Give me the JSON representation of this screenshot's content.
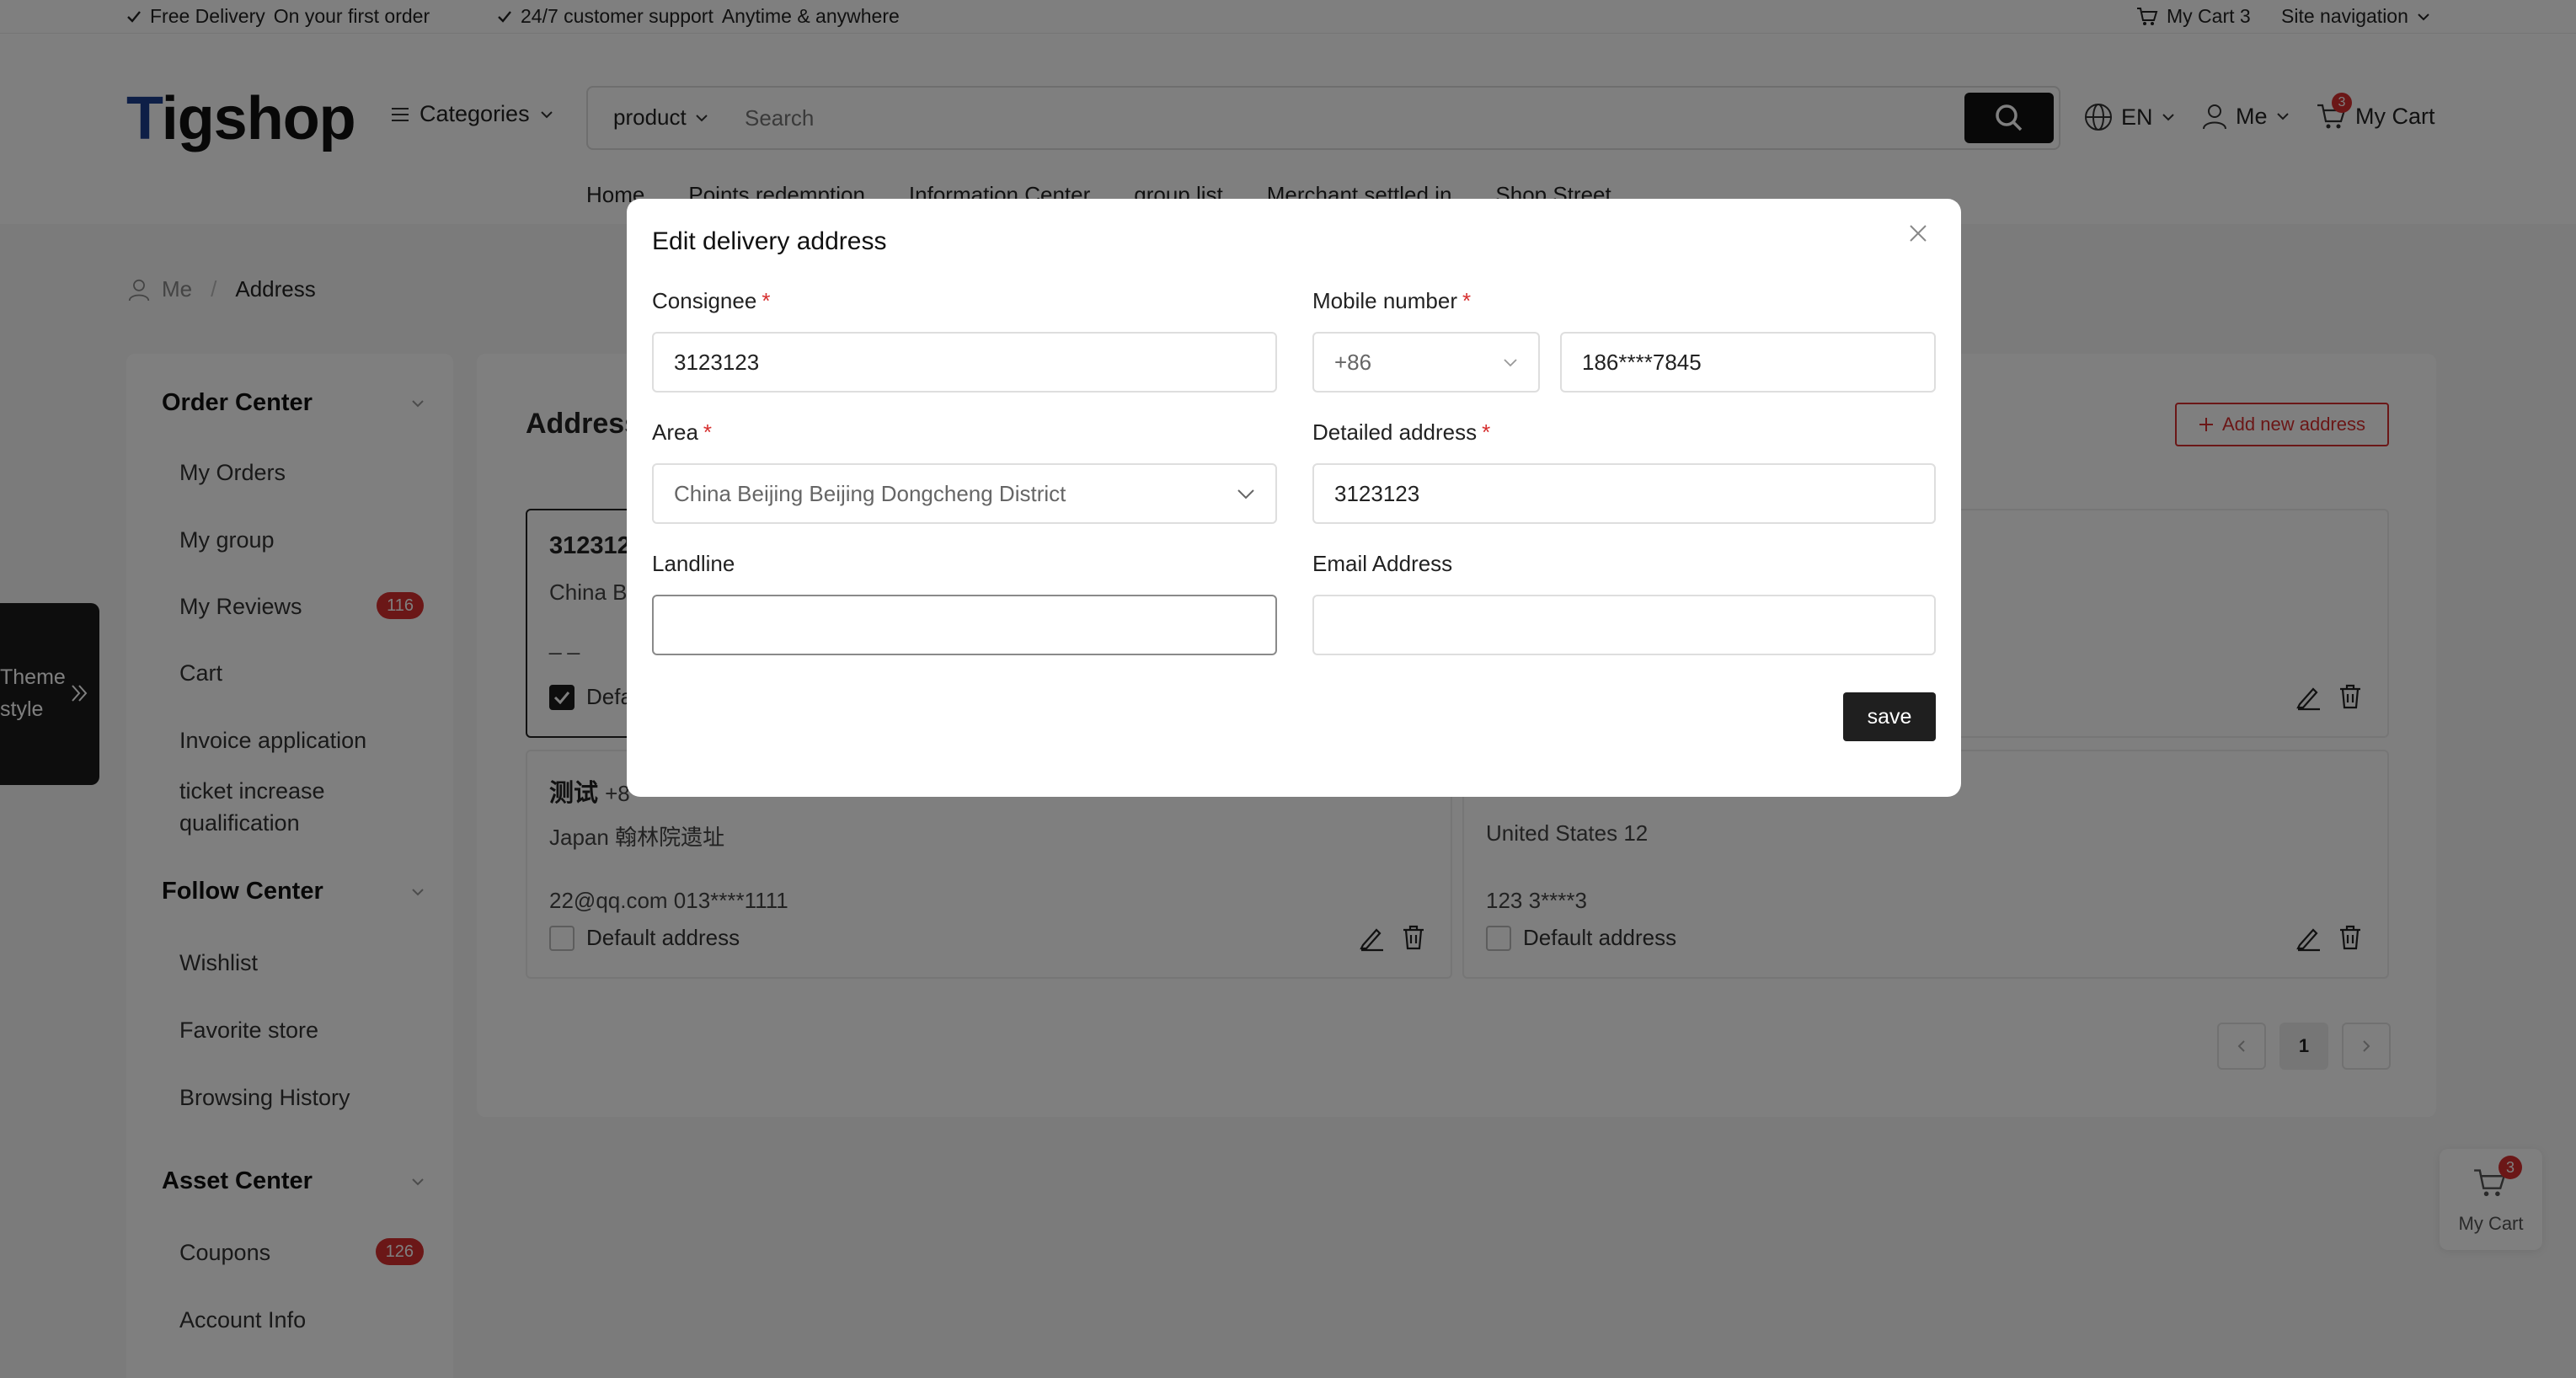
{
  "topbar": {
    "free_delivery": "Free Delivery",
    "free_delivery_sub": "On your first order",
    "support": "24/7 customer support",
    "support_sub": "Anytime & anywhere",
    "my_cart": "My Cart 3",
    "site_nav": "Site navigation"
  },
  "header": {
    "logo_first": "T",
    "logo_rest": "igshop",
    "categories": "Categories",
    "search_type": "product",
    "search_placeholder": "Search",
    "lang": "EN",
    "me": "Me",
    "cart": "My Cart",
    "cart_count": "3",
    "nav": [
      "Home",
      "Points redemption",
      "Information Center",
      "group list",
      "Merchant settled in",
      "Shop Street"
    ]
  },
  "breadcrumb": {
    "root": "Me",
    "sep": "/",
    "current": "Address"
  },
  "theme_tab": {
    "line1": "Theme",
    "line2": "style"
  },
  "sidebar": {
    "order_center": "Order Center",
    "my_orders": "My Orders",
    "my_group": "My group",
    "my_reviews": "My Reviews",
    "my_reviews_count": "116",
    "cart": "Cart",
    "invoice": "Invoice application",
    "ticket": "ticket increase qualification",
    "follow_center": "Follow Center",
    "wishlist": "Wishlist",
    "favorite_store": "Favorite store",
    "browsing_history": "Browsing History",
    "asset_center": "Asset Center",
    "coupons": "Coupons",
    "coupons_count": "126",
    "account_info": "Account Info"
  },
  "main": {
    "title": "Address",
    "add_button": "Add new address",
    "cards": [
      {
        "name": "3123123",
        "location": "China B",
        "contact": "_  _",
        "default_label": "Default address",
        "is_default": true
      },
      {
        "name": "",
        "location": "",
        "contact": "",
        "default_label": "",
        "is_default": false
      },
      {
        "name": "测试",
        "name_extra": "+8",
        "location": "Japan 翰林院遗址",
        "contact": "22@qq.com  013****1111",
        "default_label": "Default address",
        "is_default": false
      },
      {
        "name": "",
        "location": "United States 12",
        "contact": "123  3****3",
        "default_label": "Default address",
        "is_default": false
      }
    ],
    "page_current": "1"
  },
  "float_cart": {
    "label": "My Cart",
    "count": "3"
  },
  "modal": {
    "title": "Edit delivery address",
    "consignee_label": "Consignee",
    "consignee_value": "3123123",
    "mobile_label": "Mobile number",
    "country_code": "+86",
    "mobile_value": "186****7845",
    "area_label": "Area",
    "area_value": "China Beijing Beijing Dongcheng District",
    "detail_label": "Detailed address",
    "detail_value": "3123123",
    "landline_label": "Landline",
    "landline_value": "",
    "email_label": "Email Address",
    "email_value": "",
    "required_mark": "*",
    "save": "save"
  }
}
